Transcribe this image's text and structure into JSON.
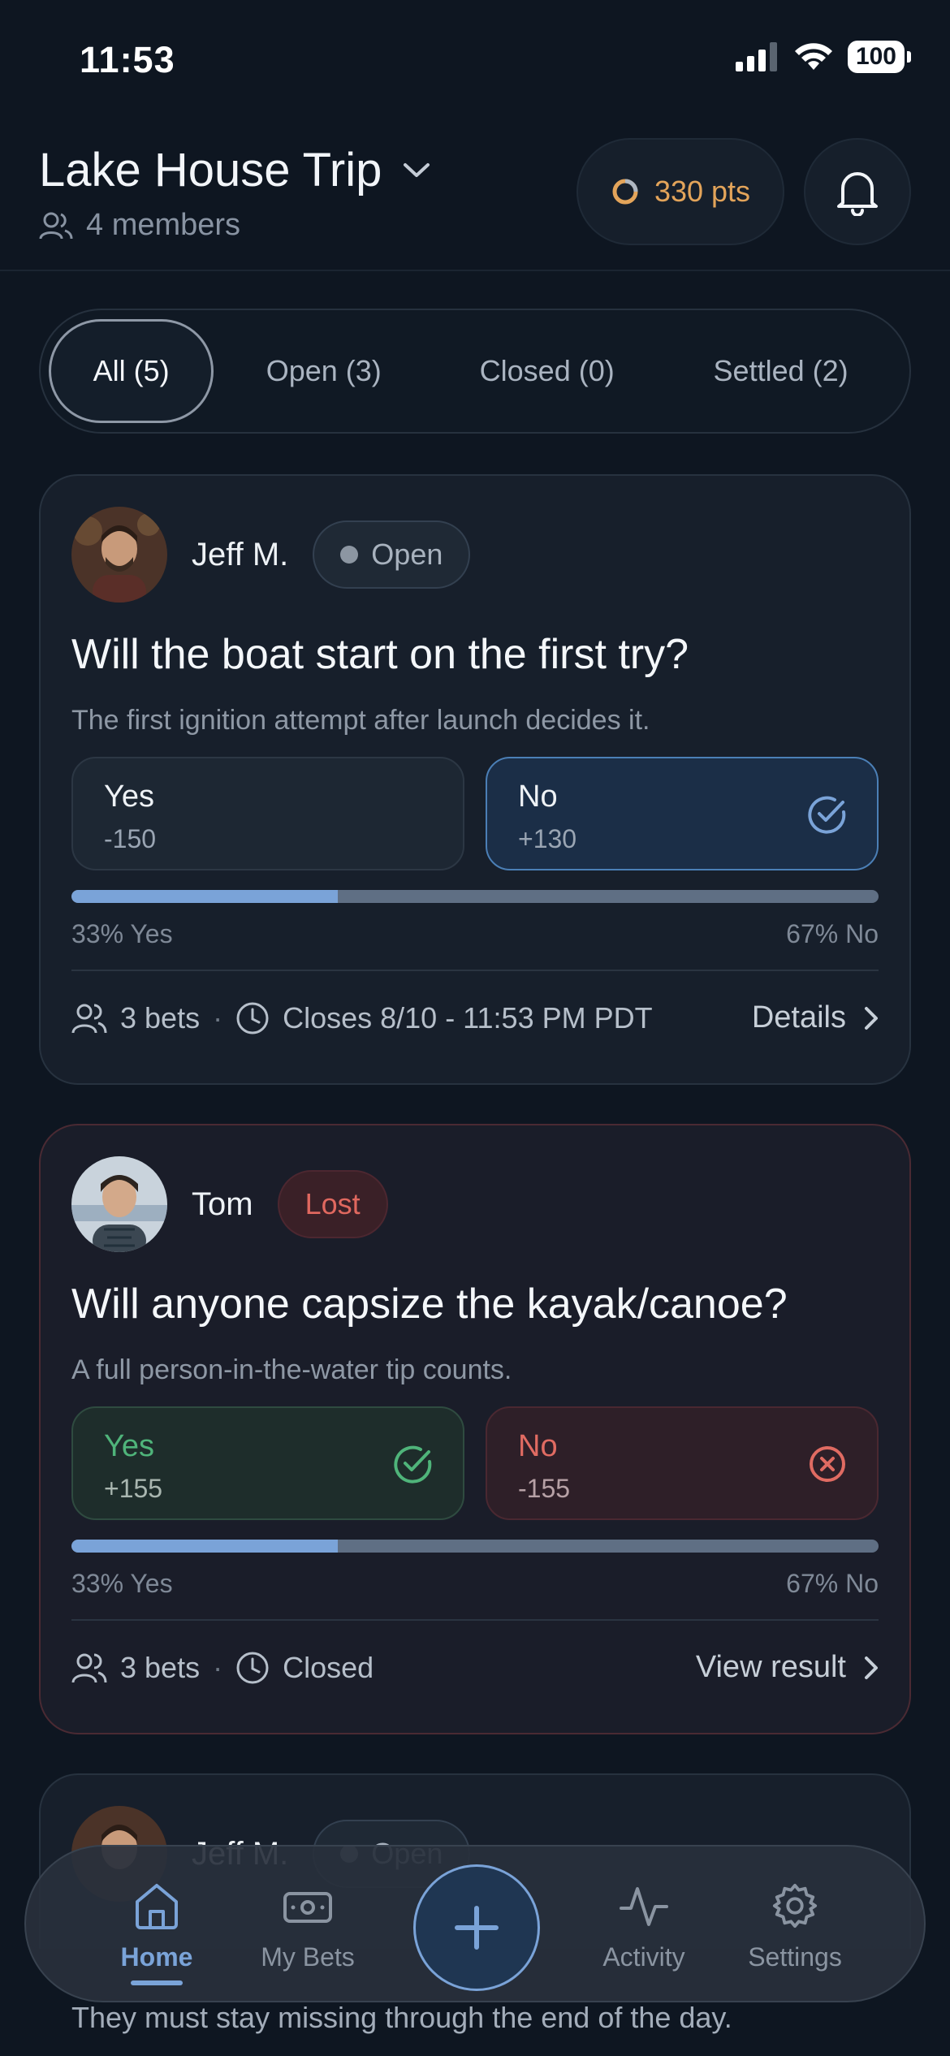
{
  "status_bar": {
    "time": "11:53",
    "battery": "100"
  },
  "header": {
    "trip_name": "Lake House Trip",
    "members": "4 members",
    "points": "330 pts"
  },
  "filters": [
    {
      "label": "All (5)",
      "active": true
    },
    {
      "label": "Open (3)",
      "active": false
    },
    {
      "label": "Closed (0)",
      "active": false
    },
    {
      "label": "Settled (2)",
      "active": false
    }
  ],
  "bets": [
    {
      "author": "Jeff M.",
      "status": "Open",
      "title": "Will the boat start on the first try?",
      "subtitle": "The first ignition attempt after launch decides it.",
      "options": [
        {
          "label": "Yes",
          "odds": "-150"
        },
        {
          "label": "No",
          "odds": "+130",
          "selected": true
        }
      ],
      "yes_pct_label": "33% Yes",
      "no_pct_label": "67% No",
      "yes_fraction": 0.33,
      "bets_count": "3 bets",
      "time_info": "Closes 8/10 - 11:53 PM PDT",
      "action": "Details"
    },
    {
      "author": "Tom",
      "status": "Lost",
      "title": "Will anyone capsize the kayak/canoe?",
      "subtitle": "A full person-in-the-water tip counts.",
      "options": [
        {
          "label": "Yes",
          "odds": "+155",
          "result": "won"
        },
        {
          "label": "No",
          "odds": "-155",
          "result": "lost"
        }
      ],
      "yes_pct_label": "33% Yes",
      "no_pct_label": "67% No",
      "yes_fraction": 0.33,
      "bets_count": "3 bets",
      "time_info": "Closed",
      "action": "View result"
    },
    {
      "author": "Jeff M.",
      "status": "Open",
      "subtitle": "They must stay missing through the end of the day."
    }
  ],
  "nav": {
    "home": "Home",
    "my_bets": "My Bets",
    "activity": "Activity",
    "settings": "Settings"
  },
  "colors": {
    "accent": "#7aa3d8",
    "points": "#e3a45a",
    "win": "#4fb47a",
    "loss": "#e06b62"
  }
}
